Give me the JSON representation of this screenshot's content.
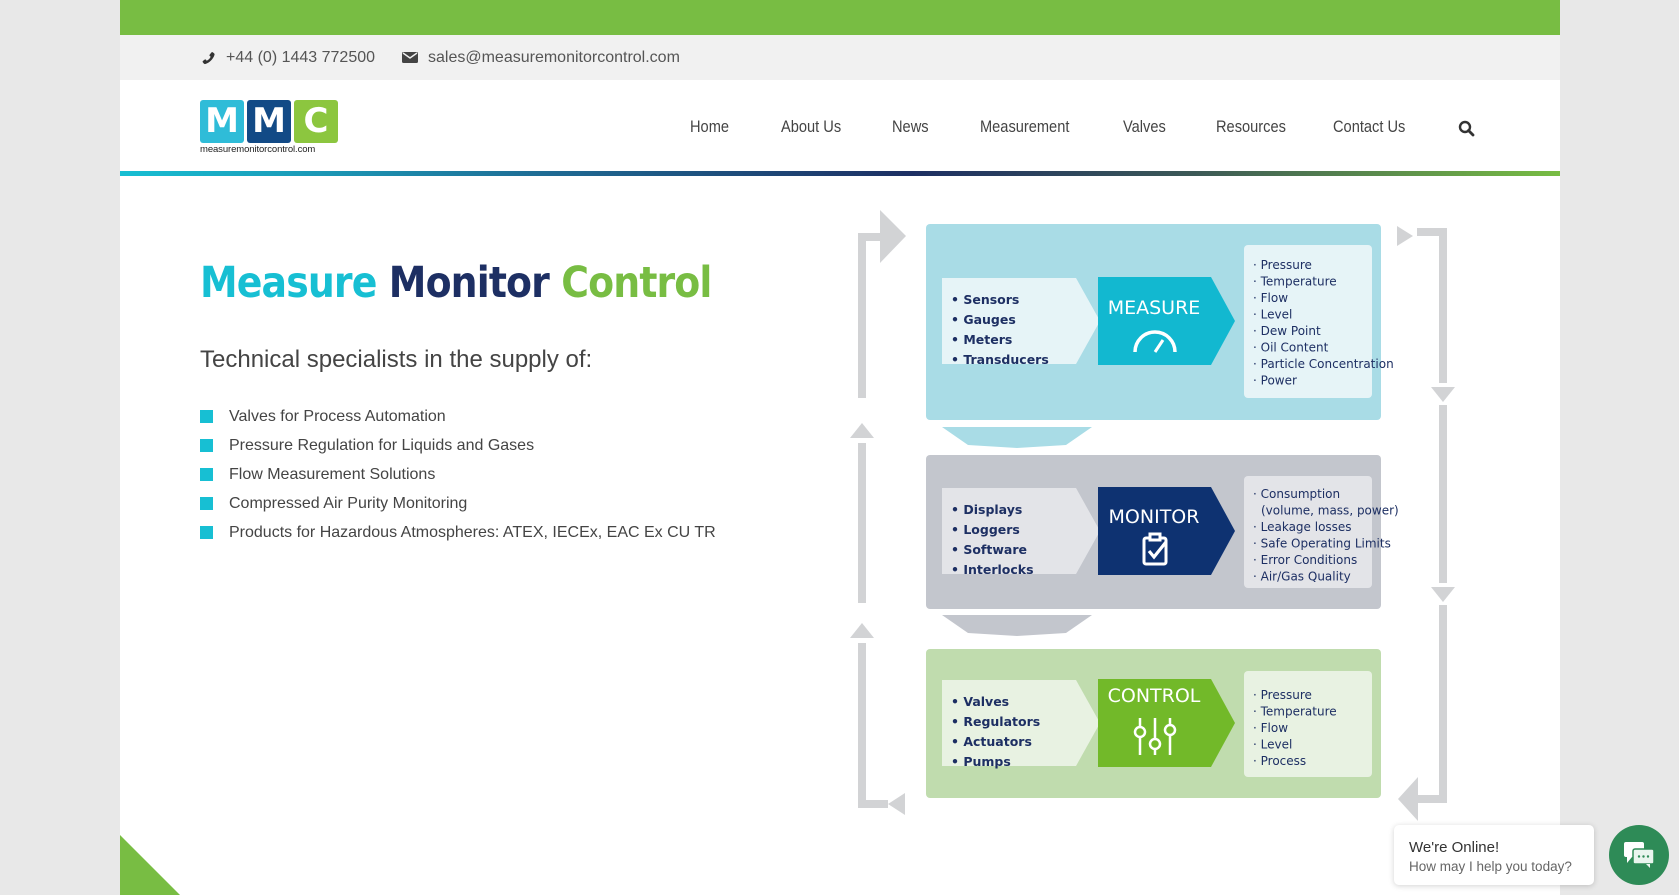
{
  "colors": {
    "brand_green": "#78bd43",
    "brand_cyan": "#17bfd3",
    "brand_navy": "#1d2f63",
    "chat_green": "#2e8b57"
  },
  "contact": {
    "phone_icon": "phone-icon",
    "phone": "+44 (0) 1443 772500",
    "email_icon": "envelope-icon",
    "email": "sales@measuremonitorcontrol.com"
  },
  "logo": {
    "letters": [
      "M",
      "M",
      "C"
    ],
    "domain": "measuremonitorcontrol.com"
  },
  "nav": {
    "items": [
      {
        "label": "Home"
      },
      {
        "label": "About Us"
      },
      {
        "label": "News"
      },
      {
        "label": "Measurement"
      },
      {
        "label": "Valves"
      },
      {
        "label": "Resources"
      },
      {
        "label": "Contact Us"
      }
    ],
    "search_icon": "search-icon"
  },
  "hero": {
    "title_parts": [
      "Measure",
      "Monitor",
      "Control"
    ],
    "subtitle": "Technical specialists in the supply of:",
    "items": [
      "Valves for Process Automation",
      "Pressure Regulation for Liquids and Gases",
      "Flow Measurement Solutions",
      "Compressed Air Purity Monitoring",
      "Products for Hazardous Atmospheres: ATEX, IECEx, EAC Ex CU TR"
    ]
  },
  "diagram": {
    "stages": [
      {
        "name": "MEASURE",
        "icon": "gauge-icon",
        "inputs": [
          "Sensors",
          "Gauges",
          "Meters",
          "Transducers"
        ],
        "outputs": [
          "Pressure",
          "Temperature",
          "Flow",
          "Level",
          "Dew Point",
          "Oil Content",
          "Particle Concentration",
          "Power"
        ]
      },
      {
        "name": "MONITOR",
        "icon": "clipboard-check-icon",
        "inputs": [
          "Displays",
          "Loggers",
          "Software",
          "Interlocks"
        ],
        "outputs": [
          "Consumption",
          "(volume, mass, power)",
          "Leakage losses",
          "Safe Operating Limits",
          "Error Conditions",
          "Air/Gas Quality"
        ]
      },
      {
        "name": "CONTROL",
        "icon": "sliders-icon",
        "inputs": [
          "Valves",
          "Regulators",
          "Actuators",
          "Pumps"
        ],
        "outputs": [
          "Pressure",
          "Temperature",
          "Flow",
          "Level",
          "Process"
        ]
      }
    ]
  },
  "chat": {
    "title": "We're Online!",
    "subtitle": "How may I help you today?",
    "icon": "chat-bubbles-icon"
  }
}
